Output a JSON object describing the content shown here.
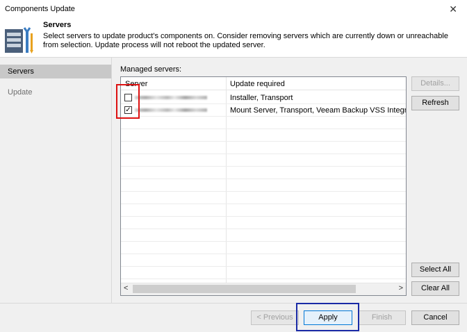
{
  "window": {
    "title": "Components Update",
    "close_glyph": "✕"
  },
  "header": {
    "title": "Servers",
    "description": "Select servers to update product's components on. Consider removing servers which are currently down or unreachable from selection. Update process will not reboot the updated server.",
    "icon": "servers-update-icon"
  },
  "nav": {
    "items": [
      {
        "label": "Servers",
        "selected": true
      },
      {
        "label": "Update",
        "selected": false
      }
    ]
  },
  "managed": {
    "label": "Managed servers:",
    "columns": [
      "Server",
      "Update required"
    ],
    "rows": [
      {
        "checked": false,
        "server": "",
        "update": "Installer, Transport"
      },
      {
        "checked": true,
        "server": "",
        "update": "Mount Server, Transport, Veeam Backup VSS Integration"
      }
    ],
    "scroll_left": "<",
    "scroll_right": ">"
  },
  "side_buttons": {
    "details": "Details...",
    "refresh": "Refresh",
    "select_all": "Select All",
    "clear_all": "Clear All"
  },
  "footer": {
    "previous": "< Previous",
    "apply": "Apply",
    "finish": "Finish",
    "cancel": "Cancel"
  },
  "colors": {
    "highlight_red": "#dd1111",
    "highlight_blue": "#1a2aa6",
    "accent": "#0078d7"
  }
}
